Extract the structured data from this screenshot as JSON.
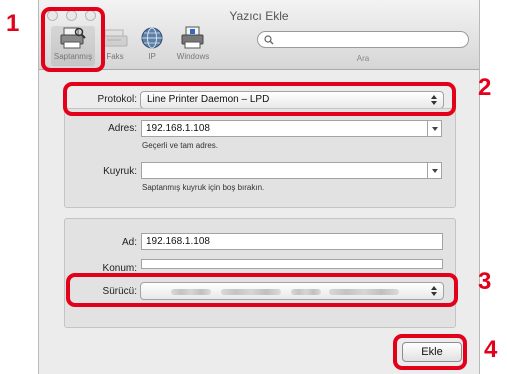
{
  "window": {
    "title": "Yazıcı Ekle"
  },
  "toolbar": {
    "items": [
      {
        "label": "Saptanmış",
        "icon": "default-printer-icon"
      },
      {
        "label": "Faks",
        "icon": "fax-icon"
      },
      {
        "label": "IP",
        "icon": "globe-icon"
      },
      {
        "label": "Windows",
        "icon": "windows-printer-icon"
      }
    ],
    "search_placeholder": "",
    "search_label": "Ara"
  },
  "form": {
    "protocol_label": "Protokol:",
    "protocol_value": "Line Printer Daemon – LPD",
    "address_label": "Adres:",
    "address_value": "192.168.1.108",
    "address_hint": "Geçerli ve tam adres.",
    "queue_label": "Kuyruk:",
    "queue_value": "",
    "queue_hint": "Saptanmış kuyruk için boş bırakın.",
    "name_label": "Ad:",
    "name_value": "192.168.1.108",
    "location_label": "Konum:",
    "location_value": "",
    "driver_label": "Sürücü:",
    "driver_value": "",
    "add_button": "Ekle"
  },
  "callouts": [
    "1",
    "2",
    "3",
    "4"
  ],
  "colors": {
    "highlight": "#e2001a",
    "window_bg": "#ececec"
  }
}
